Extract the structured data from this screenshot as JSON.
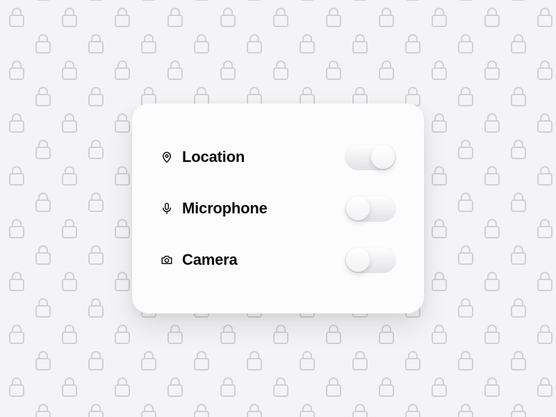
{
  "permissions": [
    {
      "icon": "location-pin-icon",
      "label": "Location",
      "enabled": true
    },
    {
      "icon": "microphone-icon",
      "label": "Microphone",
      "enabled": false
    },
    {
      "icon": "camera-icon",
      "label": "Camera",
      "enabled": false
    }
  ]
}
